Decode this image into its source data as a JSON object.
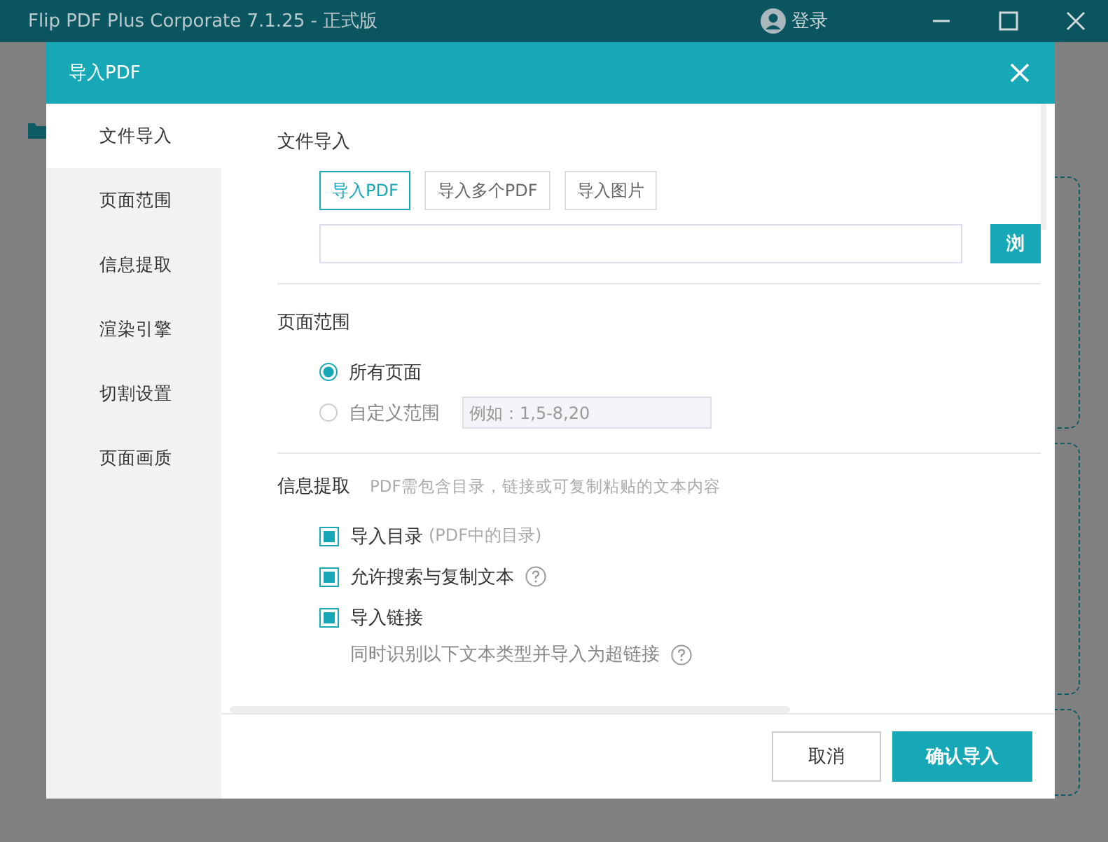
{
  "app": {
    "title": "Flip PDF Plus Corporate 7.1.25 - 正式版",
    "login": "登录"
  },
  "dialog": {
    "title": "导入PDF",
    "nav": [
      {
        "label": "文件导入",
        "selected": true
      },
      {
        "label": "页面范围",
        "selected": false
      },
      {
        "label": "信息提取",
        "selected": false
      },
      {
        "label": "渲染引擎",
        "selected": false
      },
      {
        "label": "切割设置",
        "selected": false
      },
      {
        "label": "页面画质",
        "selected": false
      }
    ],
    "file_import": {
      "title": "文件导入",
      "tabs": [
        {
          "label": "导入PDF",
          "selected": true
        },
        {
          "label": "导入多个PDF",
          "selected": false
        },
        {
          "label": "导入图片",
          "selected": false
        }
      ],
      "browse": "浏"
    },
    "page_range": {
      "title": "页面范围",
      "options": [
        {
          "label": "所有页面",
          "selected": true
        },
        {
          "label": "自定义范围",
          "selected": false
        }
      ],
      "range_placeholder": "例如：1,5-8,20"
    },
    "info": {
      "title": "信息提取",
      "hint": "PDF需包含目录，链接或可复制粘贴的文本内容",
      "options": [
        {
          "label": "导入目录",
          "note": "(PDF中的目录)",
          "help": false,
          "checked": true
        },
        {
          "label": "允许搜索与复制文本",
          "help": true,
          "checked": true
        },
        {
          "label": "导入链接",
          "help": false,
          "checked": true
        }
      ],
      "sub": {
        "label": "同时识别以下文本类型并导入为超链接",
        "help": true
      }
    },
    "buttons": [
      {
        "label": "取消",
        "kind": "secondary"
      },
      {
        "label": "确认导入",
        "kind": "primary"
      }
    ]
  }
}
